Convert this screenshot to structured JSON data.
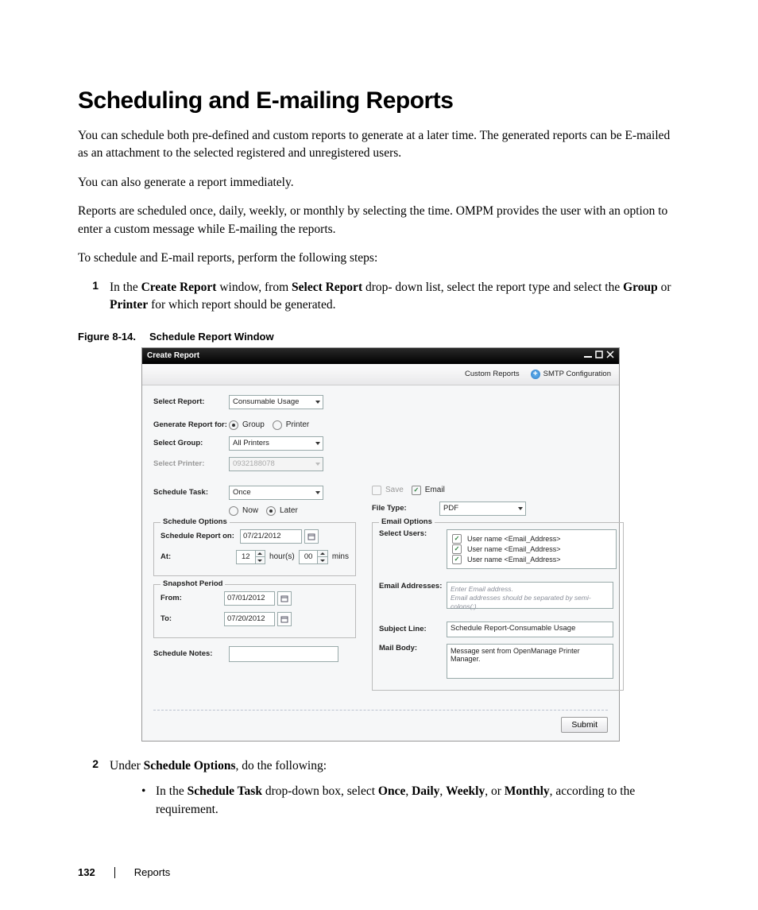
{
  "heading": "Scheduling and E-mailing Reports",
  "p1": "You can schedule both pre-defined and custom reports to generate at a later time. The generated reports can be E-mailed as an attachment to the selected registered and unregistered users.",
  "p2": "You can also generate a report immediately.",
  "p3": "Reports are scheduled once, daily, weekly, or monthly by selecting the time. OMPM provides the user with an option to enter a custom message while E-mailing the reports.",
  "p4": "To schedule and E-mail reports, perform the following steps:",
  "step1": {
    "num": "1",
    "pre": "In the ",
    "b1": "Create Report",
    "mid1": " window, from ",
    "b2": "Select Report",
    "mid2": " drop- down list, select the report type and select the ",
    "b3": "Group",
    "mid3": " or ",
    "b4": "Printer",
    "post": " for which report should be generated."
  },
  "figcap": {
    "num": "Figure 8-14.",
    "title": "Schedule Report Window"
  },
  "window": {
    "title": "Create Report",
    "toolbar": {
      "custom": "Custom Reports",
      "smtp": "SMTP Configuration"
    },
    "labels": {
      "selectReport": "Select Report:",
      "generateFor": "Generate Report for:",
      "selectGroup": "Select Group:",
      "selectPrinter": "Select Printer:",
      "scheduleTask": "Schedule Task:",
      "scheduleOptions": "Schedule Options",
      "scheduleReportOn": "Schedule Report on:",
      "at": "At:",
      "hours": "hour(s)",
      "mins": "mins",
      "snapshot": "Snapshot Period",
      "from": "From:",
      "to": "To:",
      "scheduleNotes": "Schedule Notes:",
      "save": "Save",
      "email": "Email",
      "fileType": "File Type:",
      "emailOptions": "Email Options",
      "selectUsers": "Select Users:",
      "emailAddresses": "Email Addresses:",
      "subjectLine": "Subject Line:",
      "mailBody": "Mail Body:",
      "now": "Now",
      "later": "Later",
      "group": "Group",
      "printer": "Printer"
    },
    "values": {
      "report": "Consumable Usage",
      "groupSel": "All Printers",
      "printerSel": "0932188078",
      "task": "Once",
      "date": "07/21/2012",
      "hour": "12",
      "min": "00",
      "from": "07/01/2012",
      "to": "07/20/2012",
      "fileType": "PDF",
      "userLine": "User name <Email_Address>",
      "emailHint1": "Enter Email address.",
      "emailHint2": "Email addresses should be separated by semi-colons(;).",
      "subject": "Schedule Report-Consumable Usage",
      "body": "Message sent from OpenManage Printer Manager.",
      "submit": "Submit"
    }
  },
  "step2": {
    "num": "2",
    "pre": "Under ",
    "b1": "Schedule Options",
    "post": ", do the following:"
  },
  "bullet": {
    "pre": "In the ",
    "b1": "Schedule Task",
    "mid1": " drop-down box, select ",
    "b2": "Once",
    "s1": ", ",
    "b3": "Daily",
    "s2": ", ",
    "b4": "Weekly",
    "s3": ", or ",
    "b5": "Monthly",
    "post": ", according to the requirement."
  },
  "footer": {
    "page": "132",
    "section": "Reports"
  }
}
